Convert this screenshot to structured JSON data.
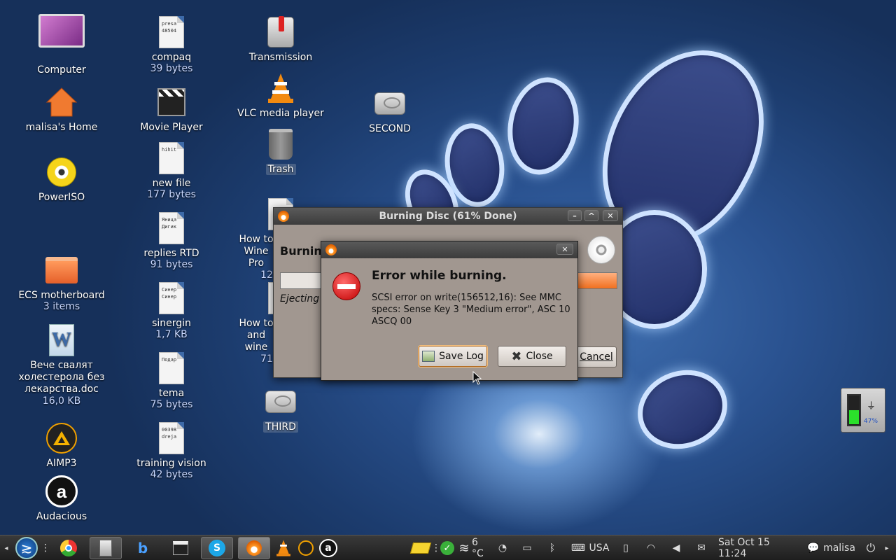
{
  "desktop": {
    "icons": {
      "computer": {
        "label": "Computer"
      },
      "home": {
        "label": "malisa's Home"
      },
      "poweriso": {
        "label": "PowerISO"
      },
      "ecs": {
        "label": "ECS motherboard",
        "sub": "3 items"
      },
      "doc": {
        "label": "Вече свалят холестерола без лекарства.doc",
        "sub": "16,0 KB"
      },
      "aimp": {
        "label": "AIMP3"
      },
      "audacious": {
        "label": "Audacious"
      },
      "compaq": {
        "label": "compaq",
        "sub": "39 bytes",
        "preview": "presa\n48504"
      },
      "movieplayer": {
        "label": "Movie Player"
      },
      "newfile": {
        "label": "new file",
        "sub": "177 bytes",
        "preview": "hihit"
      },
      "replies": {
        "label": "replies RTD",
        "sub": "91 bytes",
        "preview": "Яница\nДигик"
      },
      "sinergin": {
        "label": "sinergin",
        "sub": "1,7 KB",
        "preview": "Синер\nСинер"
      },
      "tema": {
        "label": "tema",
        "sub": "75 bytes",
        "preview": "Подар"
      },
      "training": {
        "label": "training vision",
        "sub": "42 bytes",
        "preview": "00398\ndreja"
      },
      "transmission": {
        "label": "Transmission"
      },
      "vlc": {
        "label": "VLC media player"
      },
      "trash": {
        "label": "Trash"
      },
      "howto1": {
        "label": "How to Wine Pro",
        "sub": "12"
      },
      "howto2": {
        "label": "How to and wine",
        "sub": "71"
      },
      "third": {
        "label": "THIRD"
      },
      "second": {
        "label": "SECOND"
      }
    }
  },
  "burn_window": {
    "title": "Burning Disc (61% Done)",
    "heading": "Burning",
    "status": "Ejecting",
    "progress": 0.61,
    "cancel_label": "Cancel"
  },
  "error_dialog": {
    "heading": "Error while burning.",
    "message": "SCSI error on write(156512,16): See MMC specs: Sense Key 3 \"Medium error\", ASC 10 ASCQ 00",
    "save_log_label": "Save Log",
    "close_label": "Close"
  },
  "battery_widget": {
    "percent_label": "47%",
    "level": 0.47
  },
  "taskbar": {
    "weather": "6 °C",
    "keyboard_layout": "USA",
    "datetime": "Sat Oct 15 11:24",
    "user": "malisa"
  },
  "colors": {
    "accent_orange": "#f07020",
    "desktop_blue": "#2a5290"
  }
}
